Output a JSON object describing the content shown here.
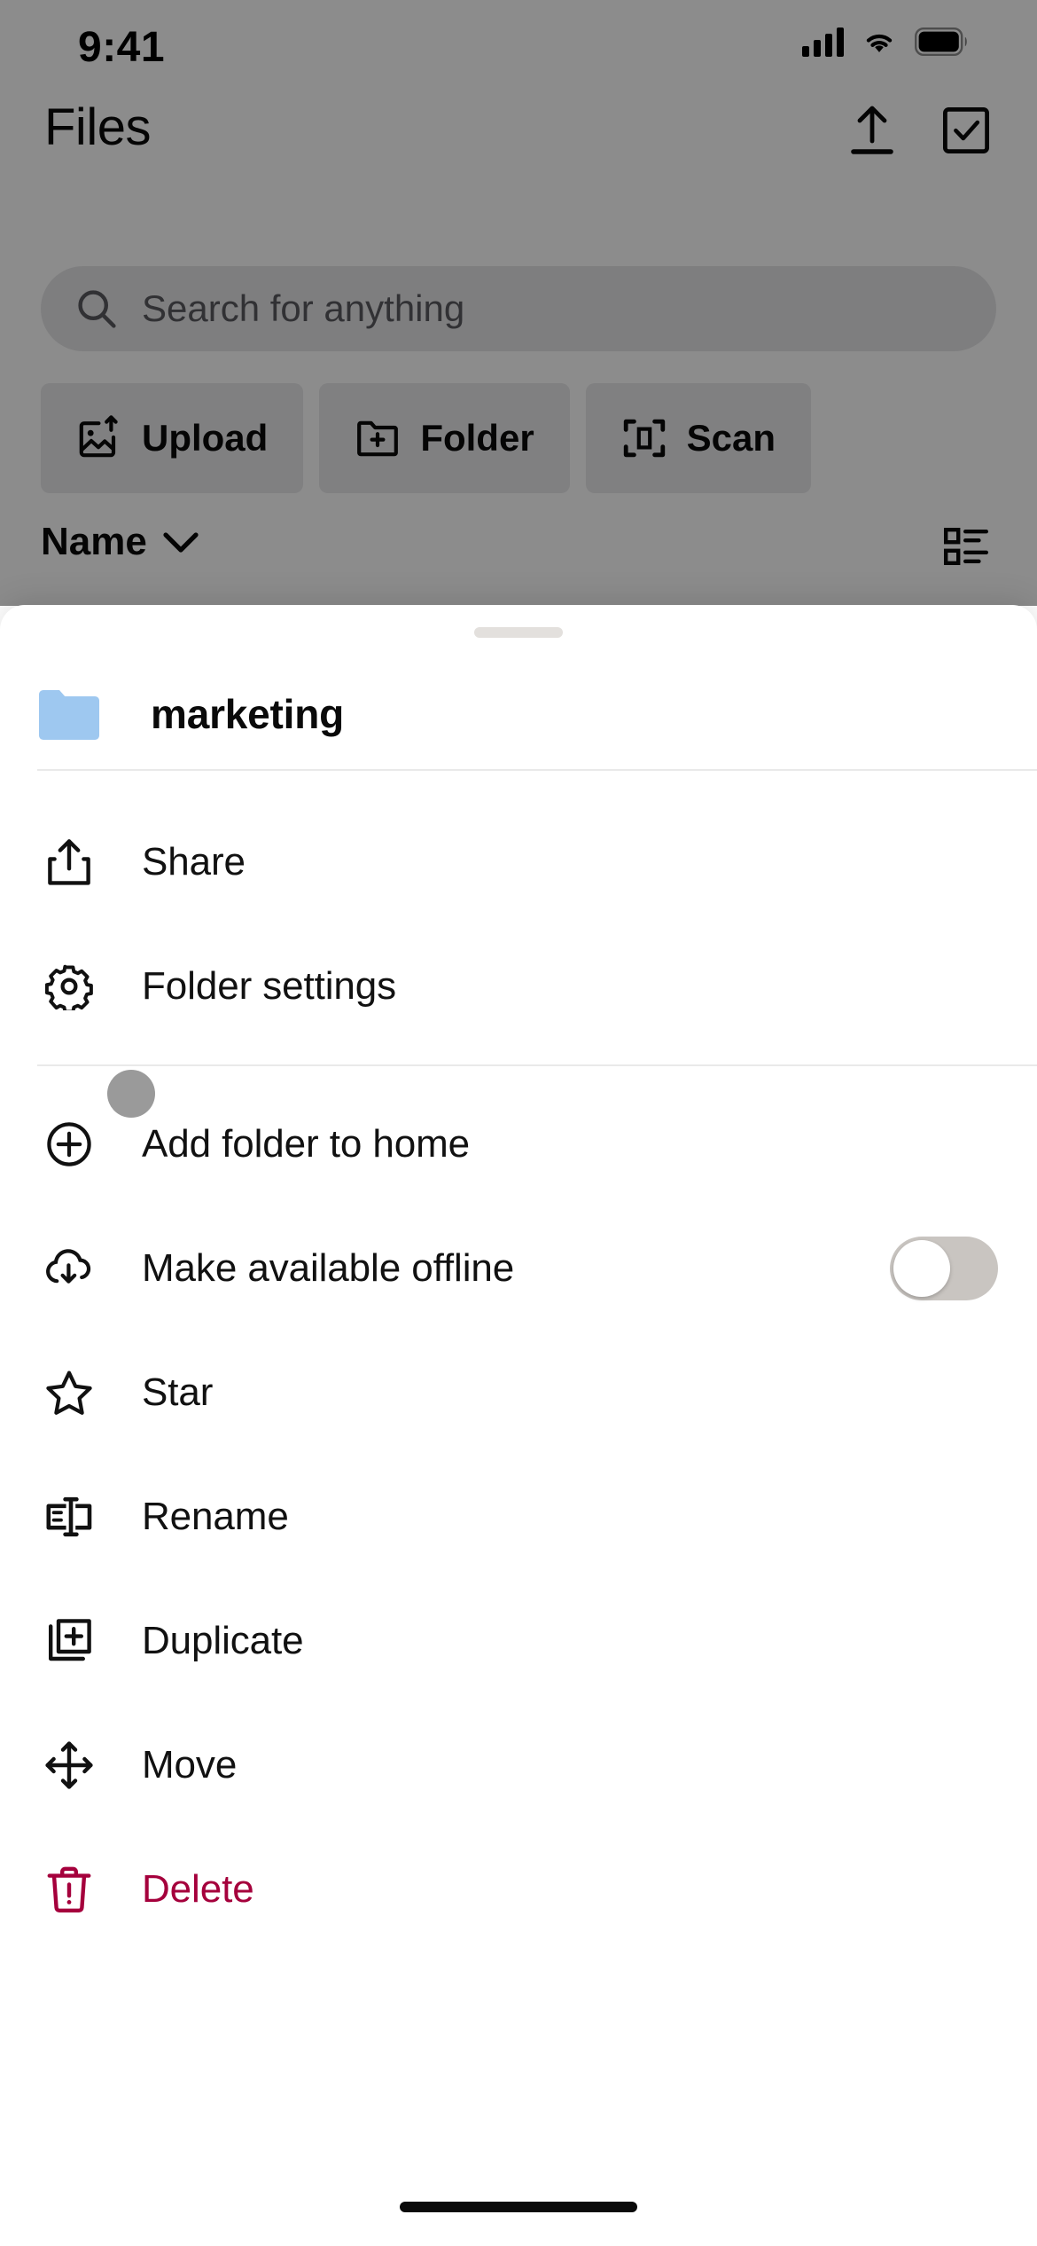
{
  "status_bar": {
    "time": "9:41",
    "icons": [
      "cellular-signal-icon",
      "wifi-icon",
      "battery-icon"
    ]
  },
  "app": {
    "title": "Files",
    "header_actions": [
      {
        "name": "upload-button",
        "icon": "upload-arrow-icon"
      },
      {
        "name": "select-button",
        "icon": "checkbox-checked-icon"
      }
    ],
    "search": {
      "placeholder": "Search for anything",
      "value": "",
      "icon": "search-icon"
    },
    "quick_actions": [
      {
        "label": "Upload",
        "icon": "image-upload-icon"
      },
      {
        "label": "Folder",
        "icon": "folder-plus-icon"
      },
      {
        "label": "Scan",
        "icon": "scan-frame-icon"
      }
    ],
    "sort": {
      "label": "Name",
      "chevron": "chevron-down-icon"
    },
    "view_toggle_icon": "list-view-icon"
  },
  "sheet": {
    "grabber": "drag-handle",
    "header": {
      "folder_icon": "folder-icon",
      "folder_icon_color": "#9EC8F0",
      "name": "marketing"
    },
    "items": [
      {
        "label": "Share",
        "icon": "share-icon",
        "type": "action",
        "danger": false
      },
      {
        "label": "Folder settings",
        "icon": "gear-icon",
        "type": "action",
        "danger": false
      },
      {
        "label": "Add folder to home",
        "icon": "plus-circle-icon",
        "type": "action",
        "danger": false
      },
      {
        "label": "Make available offline",
        "icon": "cloud-download-icon",
        "type": "toggle",
        "danger": false,
        "toggle_on": false
      },
      {
        "label": "Star",
        "icon": "star-icon",
        "type": "action",
        "danger": false
      },
      {
        "label": "Rename",
        "icon": "rename-icon",
        "type": "action",
        "danger": false
      },
      {
        "label": "Duplicate",
        "icon": "duplicate-icon",
        "type": "action",
        "danger": false
      },
      {
        "label": "Move",
        "icon": "move-arrows-icon",
        "type": "action",
        "danger": false
      },
      {
        "label": "Delete",
        "icon": "trash-alert-icon",
        "type": "action",
        "danger": true
      }
    ]
  },
  "colors": {
    "danger": "#A5003C",
    "folder_blue": "#9EC8F0",
    "toggle_track_off": "#C9C5C1",
    "scrim": "rgba(0,0,0,0.45)",
    "text_primary": "#111111"
  },
  "home_indicator": "home-bar"
}
